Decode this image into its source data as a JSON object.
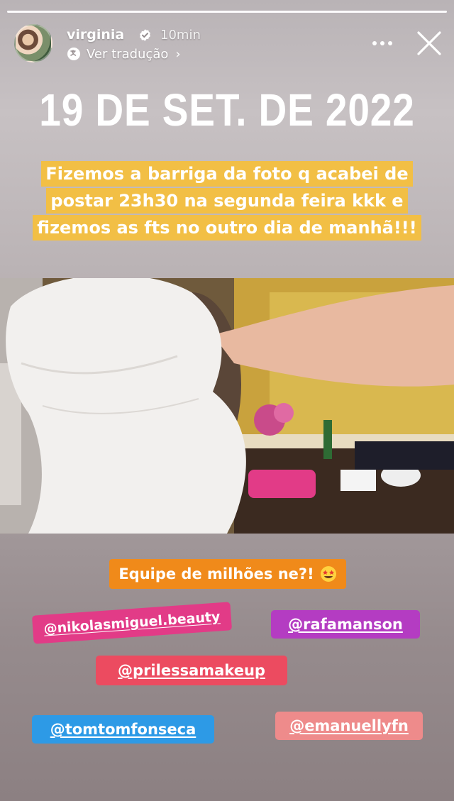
{
  "story": {
    "username": "virginia",
    "time_ago": "10min",
    "translate_label": "Ver tradução",
    "date_title": "19 DE SET. DE 2022",
    "caption": "Fizemos a barriga da foto q acabei de postar 23h30 na segunda feira kkk e fizemos as fts no outro dia de manhã!!!",
    "team_text": "Equipe de milhões ne?!",
    "mentions": [
      "@nikolasmiguel.beauty",
      "@rafamanson",
      "@prilessamakeup",
      "@tomtomfonseca",
      "@emanuellyfn"
    ]
  },
  "icons": {
    "verified": "verified-badge-icon",
    "translate": "translate-icon",
    "more": "more-options-icon",
    "close": "close-icon",
    "emoji": "star-struck-emoji-icon"
  },
  "colors": {
    "caption_bg": "#f2bf45",
    "team_bg": "#f08a1a",
    "mention_pink": "#e23b87",
    "mention_purple": "#b43cc2",
    "mention_red": "#ec4b60",
    "mention_blue": "#2d9ae6",
    "mention_salmon": "#ee8b8b"
  }
}
